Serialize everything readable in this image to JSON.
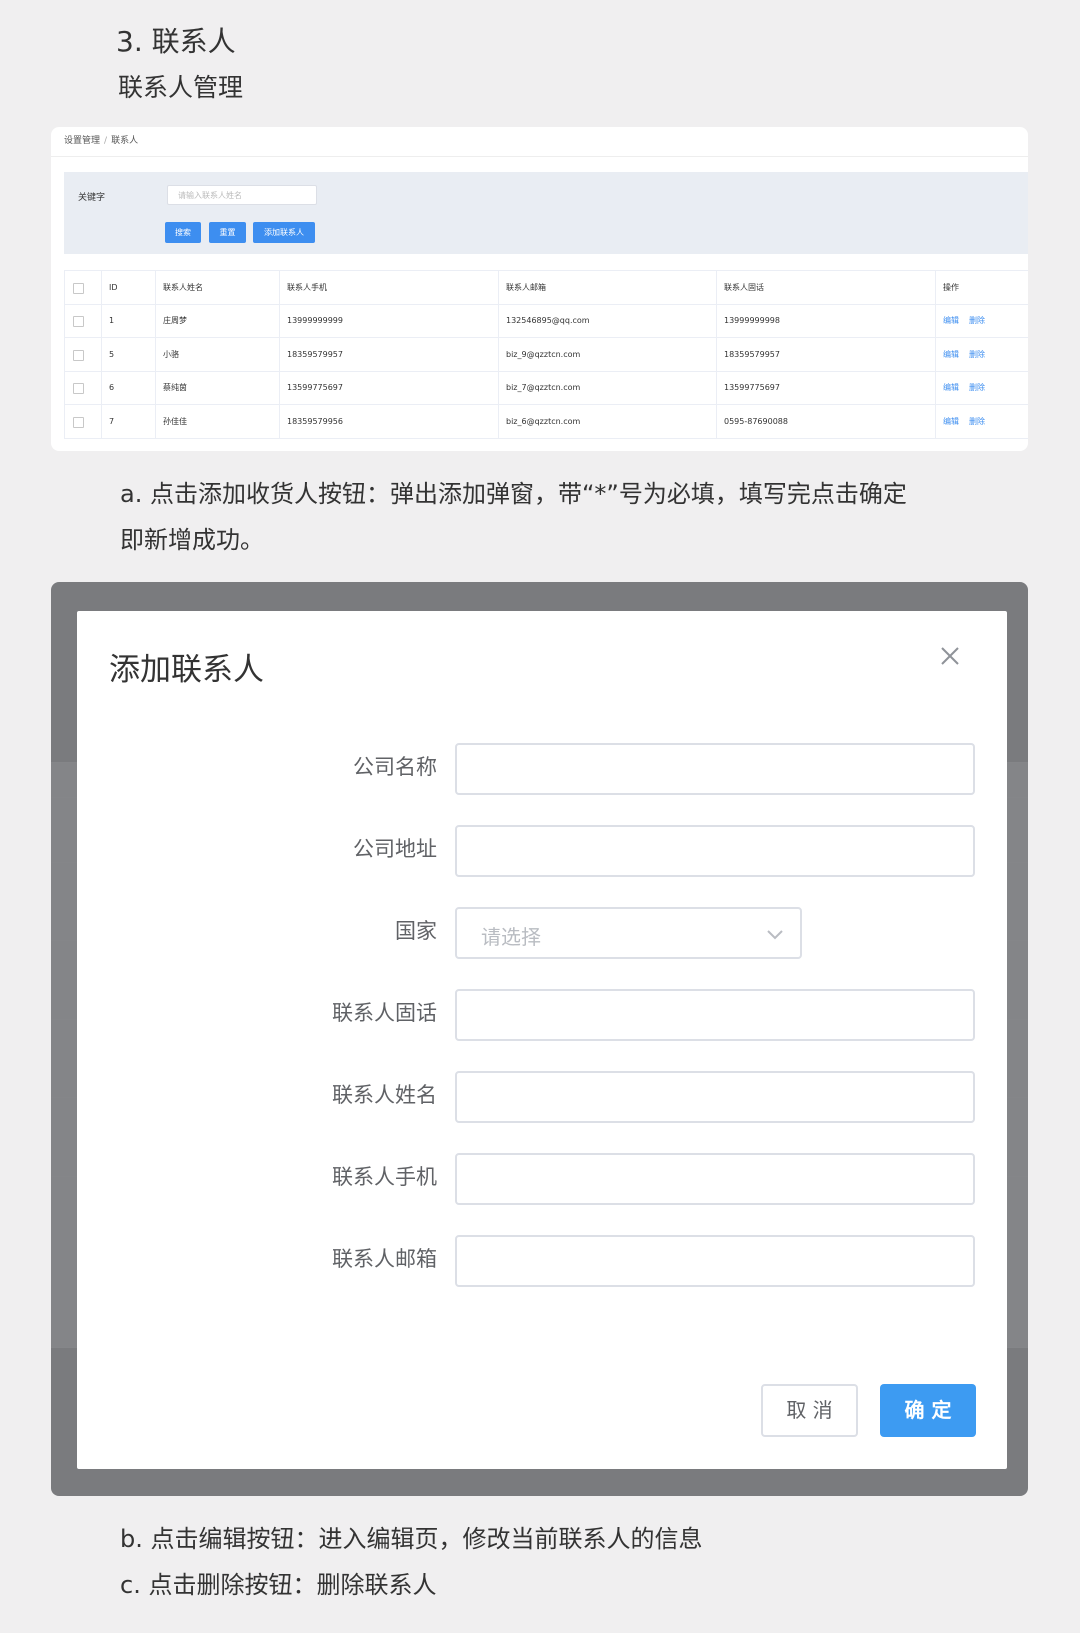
{
  "doc": {
    "title": "3. 联系人",
    "subtitle": "联系人管理",
    "para_a_line1": "a. 点击添加收货人按钮：弹出添加弹窗，带“*”号为必填，填写完点击确定",
    "para_a_line2": "即新增成功。",
    "para_b": "b. 点击编辑按钮：进入编辑页，修改当前联系人的信息",
    "para_c": "c. 点击删除按钮：删除联系人"
  },
  "list_screen": {
    "breadcrumb": [
      "设置管理",
      "联系人"
    ],
    "breadcrumb_sep": "/",
    "search": {
      "label": "关键字",
      "placeholder": "请输入联系人姓名",
      "search_btn": "搜索",
      "reset_btn": "重置",
      "add_btn": "添加联系人"
    },
    "table": {
      "headers": [
        "ID",
        "联系人姓名",
        "联系人手机",
        "联系人邮箱",
        "联系人固话",
        "操作"
      ],
      "rows": [
        {
          "id": "1",
          "name": "庄周梦",
          "mobile": "13999999999",
          "email": "132546895@qq.com",
          "phone": "13999999998"
        },
        {
          "id": "5",
          "name": "小骆",
          "mobile": "18359579957",
          "email": "biz_9@qzztcn.com",
          "phone": "18359579957"
        },
        {
          "id": "6",
          "name": "蔡纯茵",
          "mobile": "13599775697",
          "email": "biz_7@qzztcn.com",
          "phone": "13599775697"
        },
        {
          "id": "7",
          "name": "孙佳佳",
          "mobile": "18359579956",
          "email": "biz_6@qzztcn.com",
          "phone": "0595-87690088"
        }
      ],
      "edit_label": "编辑",
      "delete_label": "删除"
    }
  },
  "modal": {
    "title": "添加联系人",
    "fields": [
      {
        "label": "公司名称",
        "type": "input",
        "value": ""
      },
      {
        "label": "公司地址",
        "type": "input",
        "value": ""
      },
      {
        "label": "国家",
        "type": "select",
        "placeholder": "请选择"
      },
      {
        "label": "联系人固话",
        "type": "input",
        "value": ""
      },
      {
        "label": "联系人姓名",
        "type": "input",
        "value": ""
      },
      {
        "label": "联系人手机",
        "type": "input",
        "value": ""
      },
      {
        "label": "联系人邮箱",
        "type": "input",
        "value": ""
      }
    ],
    "cancel_label": "取 消",
    "confirm_label": "确 定"
  },
  "colors": {
    "primary": "#3d8ef0",
    "overlay": "#7a7b7e",
    "page_bg": "#f0eff0"
  }
}
